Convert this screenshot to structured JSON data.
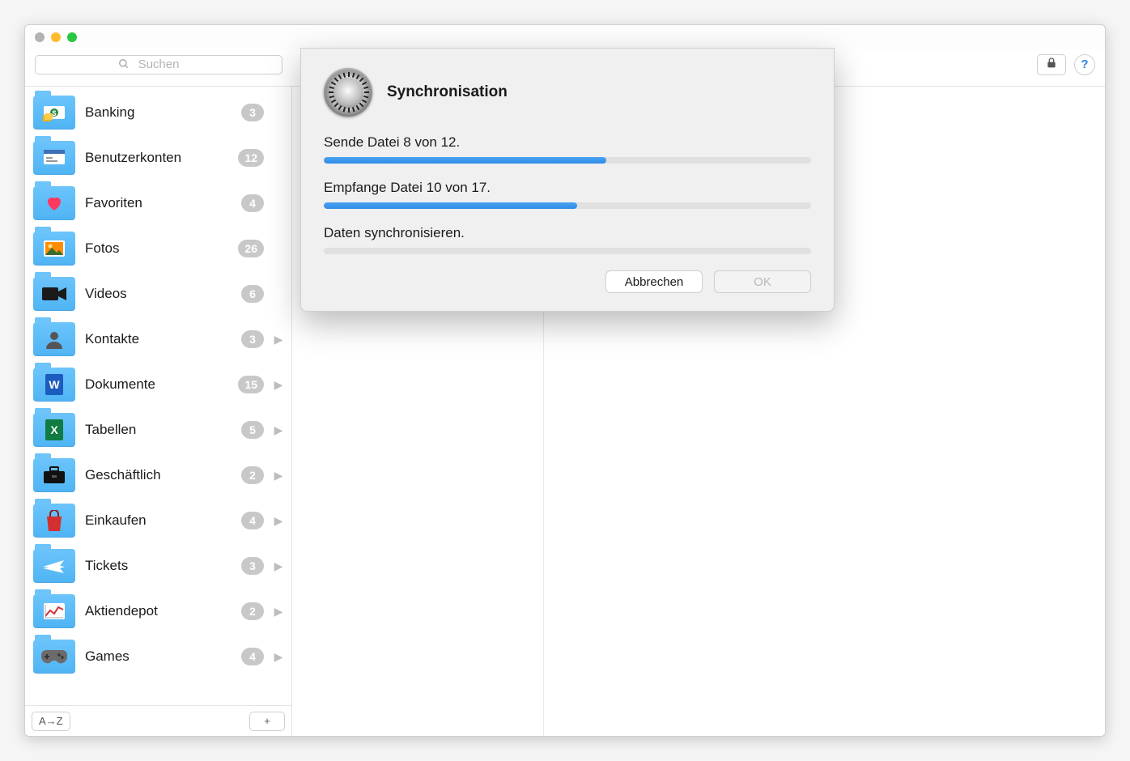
{
  "toolbar": {
    "search_placeholder": "Suchen",
    "lock_tooltip": "Sperren"
  },
  "sidebar": {
    "items": [
      {
        "label": "Banking",
        "count": "3",
        "expandable": false,
        "icon": "money-icon"
      },
      {
        "label": "Benutzerkonten",
        "count": "12",
        "expandable": false,
        "icon": "accounts-icon"
      },
      {
        "label": "Favoriten",
        "count": "4",
        "expandable": false,
        "icon": "heart-icon"
      },
      {
        "label": "Fotos",
        "count": "26",
        "expandable": false,
        "icon": "photo-icon"
      },
      {
        "label": "Videos",
        "count": "6",
        "expandable": false,
        "icon": "video-icon"
      },
      {
        "label": "Kontakte",
        "count": "3",
        "expandable": true,
        "icon": "contact-icon"
      },
      {
        "label": "Dokumente",
        "count": "15",
        "expandable": true,
        "icon": "word-doc-icon"
      },
      {
        "label": "Tabellen",
        "count": "5",
        "expandable": true,
        "icon": "spreadsheet-icon"
      },
      {
        "label": "Geschäftlich",
        "count": "2",
        "expandable": true,
        "icon": "briefcase-icon"
      },
      {
        "label": "Einkaufen",
        "count": "4",
        "expandable": true,
        "icon": "shopping-bag-icon"
      },
      {
        "label": "Tickets",
        "count": "3",
        "expandable": true,
        "icon": "plane-icon"
      },
      {
        "label": "Aktiendepot",
        "count": "2",
        "expandable": true,
        "icon": "stocks-icon"
      },
      {
        "label": "Games",
        "count": "4",
        "expandable": true,
        "icon": "gamepad-icon"
      }
    ],
    "sort_label": "A→Z",
    "add_label": "+"
  },
  "modal": {
    "title": "Synchronisation",
    "send_label": "Sende Datei 8 von 12.",
    "send_progress_percent": 58,
    "receive_label": "Empfange Datei 10 von 17.",
    "receive_progress_percent": 52,
    "sync_label": "Daten synchronisieren.",
    "sync_progress_percent": 0,
    "cancel_label": "Abbrechen",
    "ok_label": "OK"
  }
}
